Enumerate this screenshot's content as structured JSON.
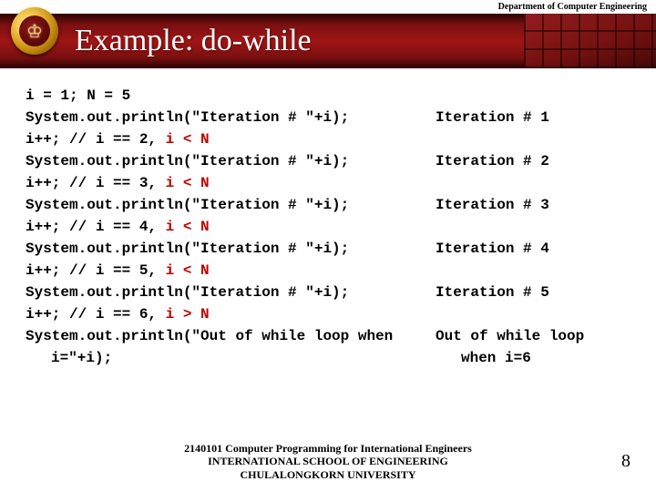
{
  "header": {
    "department": "Department of Computer Engineering",
    "title": "Example: do-while"
  },
  "code": {
    "lines": [
      {
        "pre": "i = 1; N = 5",
        "red": ""
      },
      {
        "pre": "System.out.println(\"Iteration # \"+i);",
        "red": ""
      },
      {
        "pre": "i++; // i == 2, ",
        "red": "i < N"
      },
      {
        "pre": "System.out.println(\"Iteration # \"+i);",
        "red": ""
      },
      {
        "pre": "i++; // i == 3, ",
        "red": "i < N"
      },
      {
        "pre": "System.out.println(\"Iteration # \"+i);",
        "red": ""
      },
      {
        "pre": "i++; // i == 4, ",
        "red": "i < N"
      },
      {
        "pre": "System.out.println(\"Iteration # \"+i);",
        "red": ""
      },
      {
        "pre": "i++; // i == 5, ",
        "red": "i < N"
      },
      {
        "pre": "System.out.println(\"Iteration # \"+i);",
        "red": ""
      },
      {
        "pre": "i++; // i == 6, ",
        "red": "i > N"
      },
      {
        "pre": "System.out.println(\"Out of while loop when",
        "red": ""
      },
      {
        "pre": "i=\"+i);",
        "red": "",
        "indent": true
      }
    ]
  },
  "output": {
    "lines": [
      {
        "text": ""
      },
      {
        "text": "Iteration # 1"
      },
      {
        "text": ""
      },
      {
        "text": "Iteration # 2"
      },
      {
        "text": ""
      },
      {
        "text": "Iteration # 3"
      },
      {
        "text": ""
      },
      {
        "text": "Iteration # 4"
      },
      {
        "text": ""
      },
      {
        "text": "Iteration # 5"
      },
      {
        "text": ""
      },
      {
        "text": "Out of while loop"
      },
      {
        "text": "when i=6",
        "indent": true
      }
    ]
  },
  "footer": {
    "line1": "2140101 Computer Programming for International Engineers",
    "line2": "INTERNATIONAL SCHOOL OF ENGINEERING",
    "line3": "CHULALONGKORN UNIVERSITY",
    "page": "8"
  }
}
